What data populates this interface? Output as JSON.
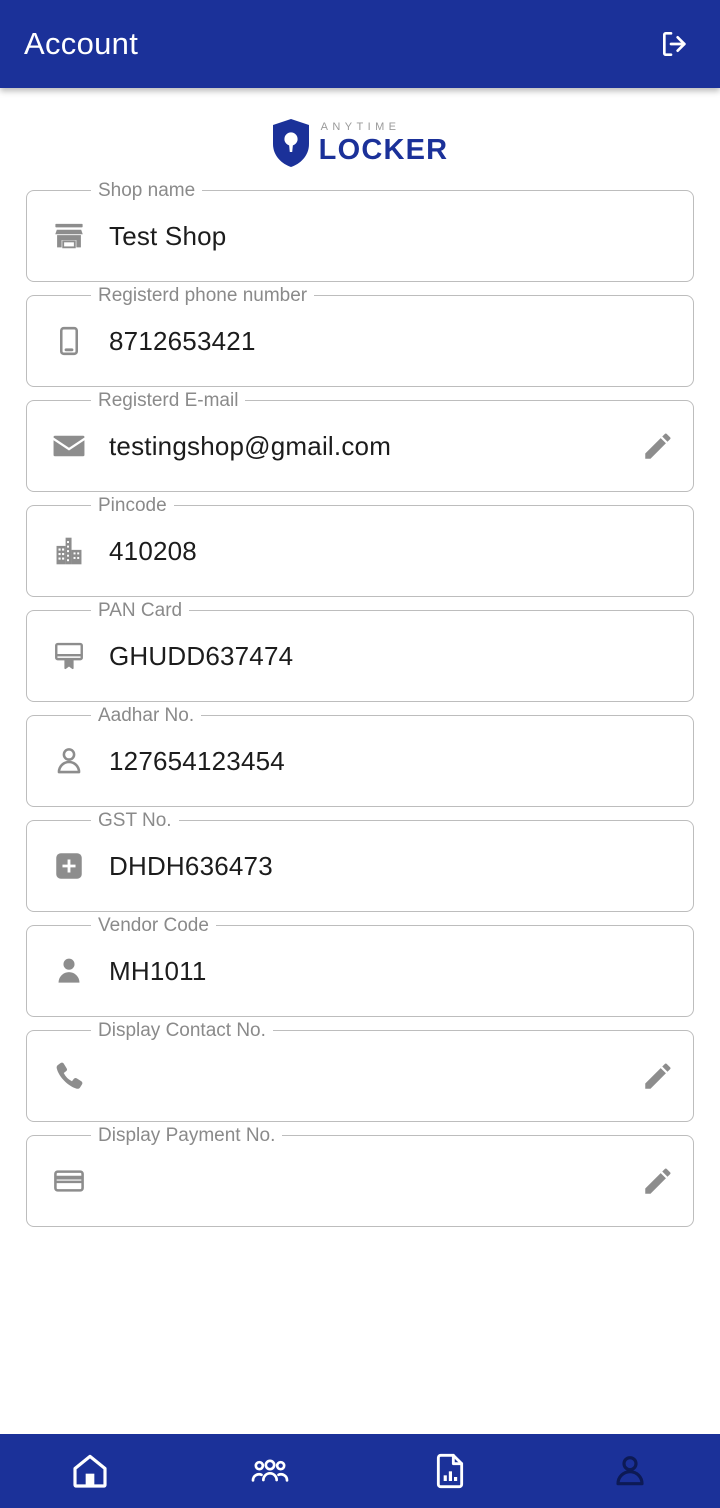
{
  "header": {
    "title": "Account",
    "logout_icon": "logout-icon"
  },
  "brand": {
    "top_word": "ANYTIME",
    "main_word": "LOCKER",
    "shield_icon": "shield-keyhole-icon",
    "accent_color": "#1B3199",
    "muted_color": "#9a9a9a"
  },
  "fields": [
    {
      "label": "Shop name",
      "value": "Test Shop",
      "icon": "storefront-icon",
      "editable": false
    },
    {
      "label": "Registerd phone number",
      "value": "8712653421",
      "icon": "smartphone-icon",
      "editable": false
    },
    {
      "label": "Registerd E-mail",
      "value": "testingshop@gmail.com",
      "icon": "email-icon",
      "editable": true
    },
    {
      "label": "Pincode",
      "value": "410208",
      "icon": "buildings-icon",
      "editable": false
    },
    {
      "label": "PAN Card",
      "value": "GHUDD637474",
      "icon": "id-card-icon",
      "editable": false
    },
    {
      "label": "Aadhar No.",
      "value": "127654123454",
      "icon": "person-outline-icon",
      "editable": false
    },
    {
      "label": "GST No.",
      "value": "DHDH636473",
      "icon": "plus-square-icon",
      "editable": false
    },
    {
      "label": "Vendor Code",
      "value": "MH1011",
      "icon": "person-filled-icon",
      "editable": false
    },
    {
      "label": "Display Contact No.",
      "value": "",
      "icon": "phone-icon",
      "editable": true
    },
    {
      "label": "Display Payment No.",
      "value": "",
      "icon": "credit-card-icon",
      "editable": true
    }
  ],
  "bottom_nav": {
    "items": [
      {
        "name": "home",
        "icon": "home-icon",
        "active": false
      },
      {
        "name": "clients",
        "icon": "group-icon",
        "active": false
      },
      {
        "name": "reports",
        "icon": "report-icon",
        "active": false
      },
      {
        "name": "account",
        "icon": "account-icon",
        "active": true
      }
    ],
    "background_color": "#1B3199",
    "active_color": "#0d1a55"
  }
}
